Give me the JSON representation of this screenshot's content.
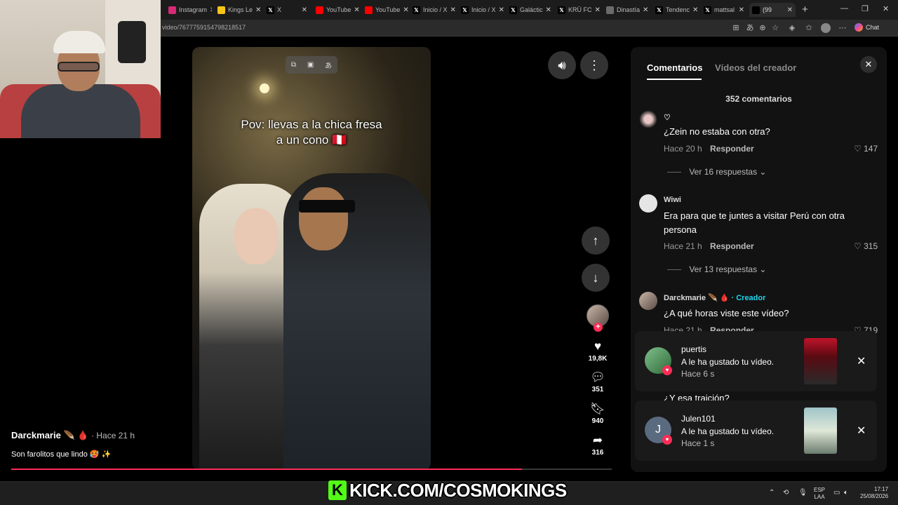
{
  "browser": {
    "tabs": [
      {
        "label": "Instagram",
        "icon": "instagram-icon",
        "color": "#d62976"
      },
      {
        "label": "Kings Le",
        "icon": "kings-league-icon",
        "color": "#f5c518"
      },
      {
        "label": "X",
        "icon": "x-icon",
        "color": "#000000"
      },
      {
        "label": "YouTube",
        "icon": "youtube-icon",
        "color": "#ff0000"
      },
      {
        "label": "YouTube",
        "icon": "youtube-icon",
        "color": "#ff0000"
      },
      {
        "label": "Inicio / X",
        "icon": "x-icon",
        "color": "#000000"
      },
      {
        "label": "Inicio / X",
        "icon": "x-icon",
        "color": "#000000"
      },
      {
        "label": "Galáctic",
        "icon": "x-icon",
        "color": "#000000"
      },
      {
        "label": "KRÜ FC",
        "icon": "x-icon",
        "color": "#000000"
      },
      {
        "label": "Dinastía",
        "icon": "tab-icon",
        "color": "#6b6b6b"
      },
      {
        "label": "Tendenc",
        "icon": "x-icon",
        "color": "#000000"
      },
      {
        "label": "mattsal",
        "icon": "x-icon",
        "color": "#000000"
      },
      {
        "label": "(99",
        "icon": "tiktok-icon",
        "color": "#000000"
      }
    ],
    "url": "video/7677759154798218517",
    "chat_label": "Chat"
  },
  "video": {
    "caption_line1": "Pov: llevas a la chica fresa",
    "caption_line2": "a un cono 🇵🇪",
    "author": "Darckmarie 🪶 🩸",
    "time": "· Hace 21 h",
    "description": "Son farolitos que lindo 🥵 ✨",
    "progress": 0.85,
    "stats": {
      "likes": "19,8K",
      "comments": "351",
      "saves": "940",
      "shares": "316"
    }
  },
  "panel": {
    "tab_comments": "Comentarios",
    "tab_videos": "Vídeos del creador",
    "comment_count": "352 comentarios",
    "comments": [
      {
        "user": "♡",
        "text": "¿Zein no estaba con otra?",
        "time": "Hace 20 h",
        "reply": "Responder",
        "likes": "147",
        "replies": "Ver 16 respuestas"
      },
      {
        "user": "Wiwi",
        "text": "Era para que te juntes a visitar Perú con otra persona",
        "time": "Hace 21 h",
        "reply": "Responder",
        "likes": "315",
        "replies": "Ver 13 respuestas"
      },
      {
        "user": "Darckmarie 🪶 🩸",
        "creator_tag": "· Creador",
        "text": "¿A qué horas viste este vídeo?",
        "time": "Hace 21 h",
        "reply": "Responder",
        "likes": "719"
      },
      {
        "text": "¿Y esa traición?"
      }
    ]
  },
  "notifications": [
    {
      "user": "puertis",
      "text": "A le ha gustado tu vídeo.",
      "time": "Hace 6 s"
    },
    {
      "user": "Julen101",
      "avatar_letter": "J",
      "text": "A le ha gustado tu vídeo.",
      "time": "Hace 1 s"
    }
  ],
  "overlay": {
    "kick_text": "KICK.COM/COSMOKINGS"
  },
  "taskbar": {
    "lang_line1": "ESP",
    "lang_line2": "LAA",
    "time": "17:17",
    "date": "25/08/2026"
  },
  "colors": {
    "accent": "#fe2c55",
    "creator_tag": "#20d5ec",
    "kick_green": "#53fc18"
  }
}
